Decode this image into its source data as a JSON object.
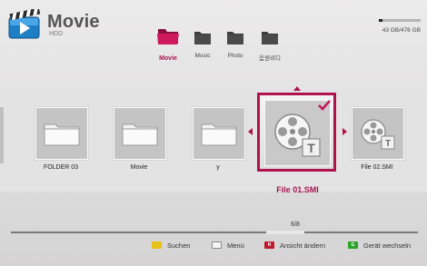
{
  "header": {
    "title": "Movie",
    "subtitle": "HDD"
  },
  "categories": [
    {
      "label": "Movie",
      "active": true
    },
    {
      "label": "Music",
      "active": false
    },
    {
      "label": "Photo",
      "active": false
    },
    {
      "label": "음원비디",
      "active": false
    }
  ],
  "storage": {
    "text": "43 GB/476 GB",
    "used_fraction": 0.09
  },
  "items": [
    {
      "label": "FOLDER 03",
      "kind": "folder"
    },
    {
      "label": "Movie",
      "kind": "folder"
    },
    {
      "label": "y",
      "kind": "folder"
    },
    {
      "label": "File 01.SMI",
      "kind": "subtitle-file",
      "selected": true,
      "checked": true
    },
    {
      "label": "File 02.SMI",
      "kind": "subtitle-file"
    }
  ],
  "pagination": {
    "text": "6/8"
  },
  "legend": [
    {
      "label": "Suchen",
      "color": "#e8c21a",
      "key": ""
    },
    {
      "label": "Menü",
      "color": "#f4f4f4",
      "key": ""
    },
    {
      "label": "Ansicht ändern",
      "color": "#c0192c",
      "key": "R"
    },
    {
      "label": "Gerät wechseln",
      "color": "#2aa52a",
      "key": "G"
    }
  ],
  "colors": {
    "accent": "#b0134c",
    "accent_text": "#a81450"
  }
}
